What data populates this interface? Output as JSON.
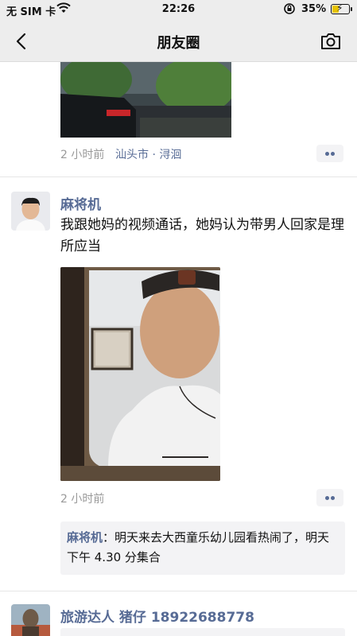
{
  "status_bar": {
    "carrier": "无 SIM 卡",
    "time": "22:26",
    "battery_percent": "35%",
    "battery_level": 0.35
  },
  "nav": {
    "title": "朋友圈"
  },
  "post_previous": {
    "time": "2 小时前",
    "location": "汕头市 · 浔洄"
  },
  "post_main": {
    "author": "麻将机",
    "text": "我跟她妈的视频通话，她妈认为带男人回家是理所应当",
    "time": "2 小时前",
    "comments": [
      {
        "author": "麻将机",
        "separator": "：",
        "text": "明天来去大西童乐幼儿园看热闹了，明天下午 4.30 分集合"
      }
    ]
  },
  "post_next": {
    "author": "旅游达人 猪仔 18922688778"
  },
  "colors": {
    "link_blue": "#576b95",
    "topbar_bg": "#ededed",
    "meta_gray": "#9a9a9a"
  }
}
